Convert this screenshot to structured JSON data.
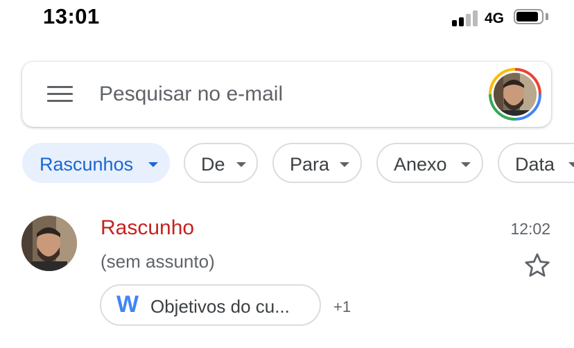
{
  "status_bar": {
    "time": "13:01",
    "network": "4G",
    "signal_bars_active": 2,
    "signal_bars_total": 4,
    "battery_level": 0.8
  },
  "search": {
    "placeholder": "Pesquisar no e-mail",
    "value": ""
  },
  "icons": {
    "menu": "hamburger-menu-icon",
    "account": "account-avatar-icon",
    "star": "star-outline-icon",
    "attachment": "word-document-icon",
    "chip_dropdown": "caret-down-icon"
  },
  "filters": [
    {
      "label": "Rascunhos",
      "selected": true
    },
    {
      "label": "De",
      "selected": false
    },
    {
      "label": "Para",
      "selected": false
    },
    {
      "label": "Anexo",
      "selected": false
    },
    {
      "label": "Data",
      "selected": false
    }
  ],
  "email": {
    "sender": "Rascunho",
    "subject": "(sem assunto)",
    "time": "12:02",
    "starred": false,
    "attachment_icon_letter": "W",
    "attachment_name": "Objetivos do cu...",
    "more_attachments": "+1"
  },
  "colors": {
    "draft_red": "#c5221f",
    "selected_chip_bg": "#e8f0fe",
    "selected_chip_text": "#1967d2",
    "word_blue": "#4285f4"
  }
}
